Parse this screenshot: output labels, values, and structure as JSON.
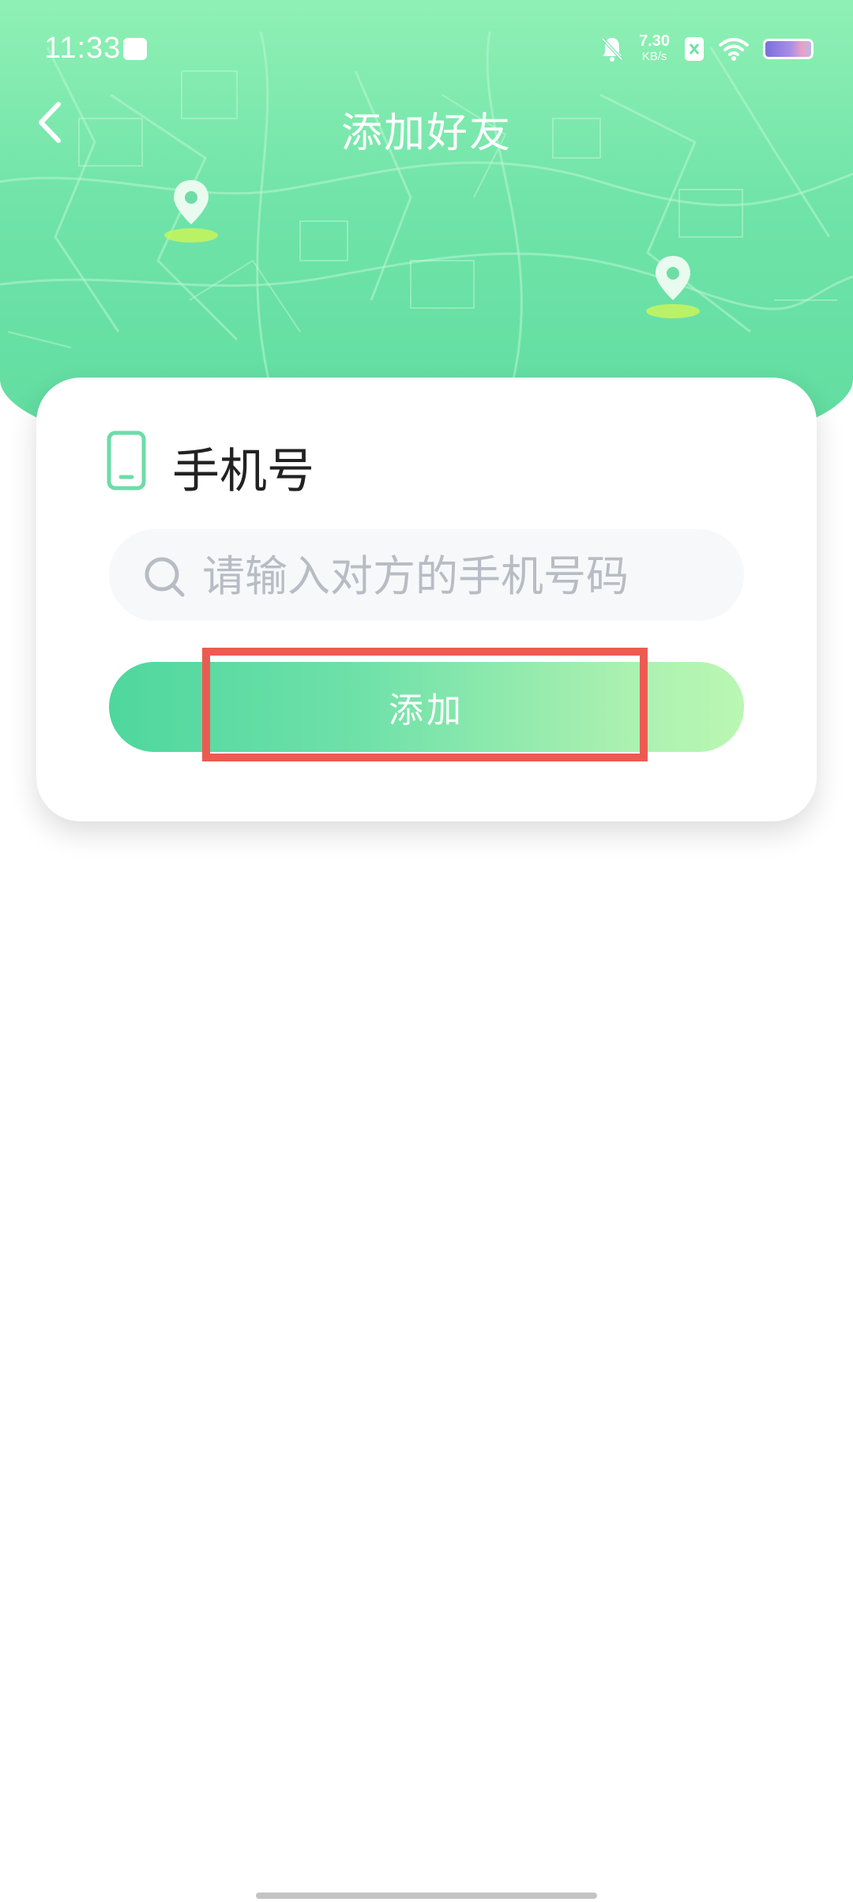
{
  "status_bar": {
    "time": "11:33",
    "net_speed_value": "7.30",
    "net_speed_unit": "KB/s",
    "icons": [
      "shopping-bag-icon",
      "mute-bell-icon",
      "sim-x-icon",
      "wifi-icon",
      "battery-icon"
    ]
  },
  "nav": {
    "title": "添加好友",
    "back_icon": "chevron-left-icon"
  },
  "card": {
    "label": "手机号",
    "label_icon": "phone-icon",
    "phone_field": {
      "value": "",
      "placeholder": "请输入对方的手机号码",
      "icon": "search-icon"
    },
    "add_button_label": "添加"
  },
  "colors": {
    "header_gradient_top": "#8ff0b4",
    "header_gradient_bottom": "#5fdca0",
    "button_gradient_start": "#4fd79e",
    "button_gradient_end": "#baf7b3",
    "highlight": "#ec5b52",
    "phone_icon": "#6cdca8"
  }
}
